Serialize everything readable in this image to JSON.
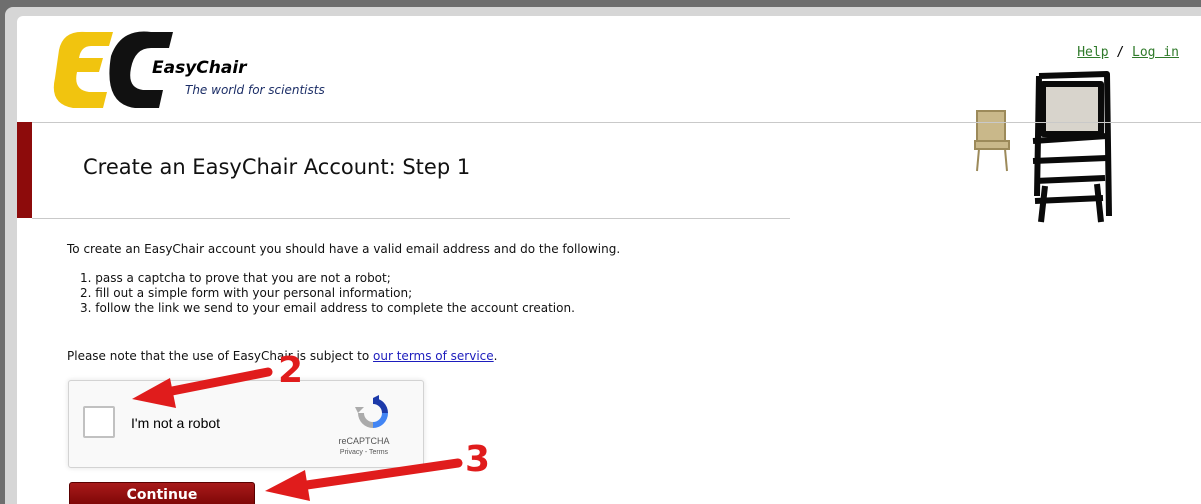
{
  "header": {
    "brand_name": "EasyChair",
    "brand_tagline": "The world for scientists",
    "links": {
      "help": "Help",
      "separator": "/",
      "login": "Log in"
    }
  },
  "page": {
    "title": "Create an EasyChair Account: Step 1",
    "intro": "To create an EasyChair account you should have a valid email address and do the following.",
    "steps": [
      "1. pass a captcha to prove that you are not a robot;",
      "2. fill out a simple form with your personal information;",
      "3. follow the link we send to your email address to complete the account creation."
    ],
    "terms_prefix": "Please note that the use of EasyChair is subject to",
    "terms_link": "our terms of service",
    "terms_suffix": "."
  },
  "recaptcha": {
    "checkbox_label": "I'm not a robot",
    "brand": "reCAPTCHA",
    "privacy": "Privacy",
    "separator": "-",
    "terms": "Terms",
    "checked": false
  },
  "actions": {
    "continue_label": "Continue"
  },
  "annotations": {
    "marker_2": "2",
    "marker_3": "3"
  },
  "colors": {
    "accent_red": "#8d0b0b",
    "annotation_red": "#e01c1c",
    "link_green": "#2f7a2a",
    "link_blue": "#1d1dbd"
  }
}
